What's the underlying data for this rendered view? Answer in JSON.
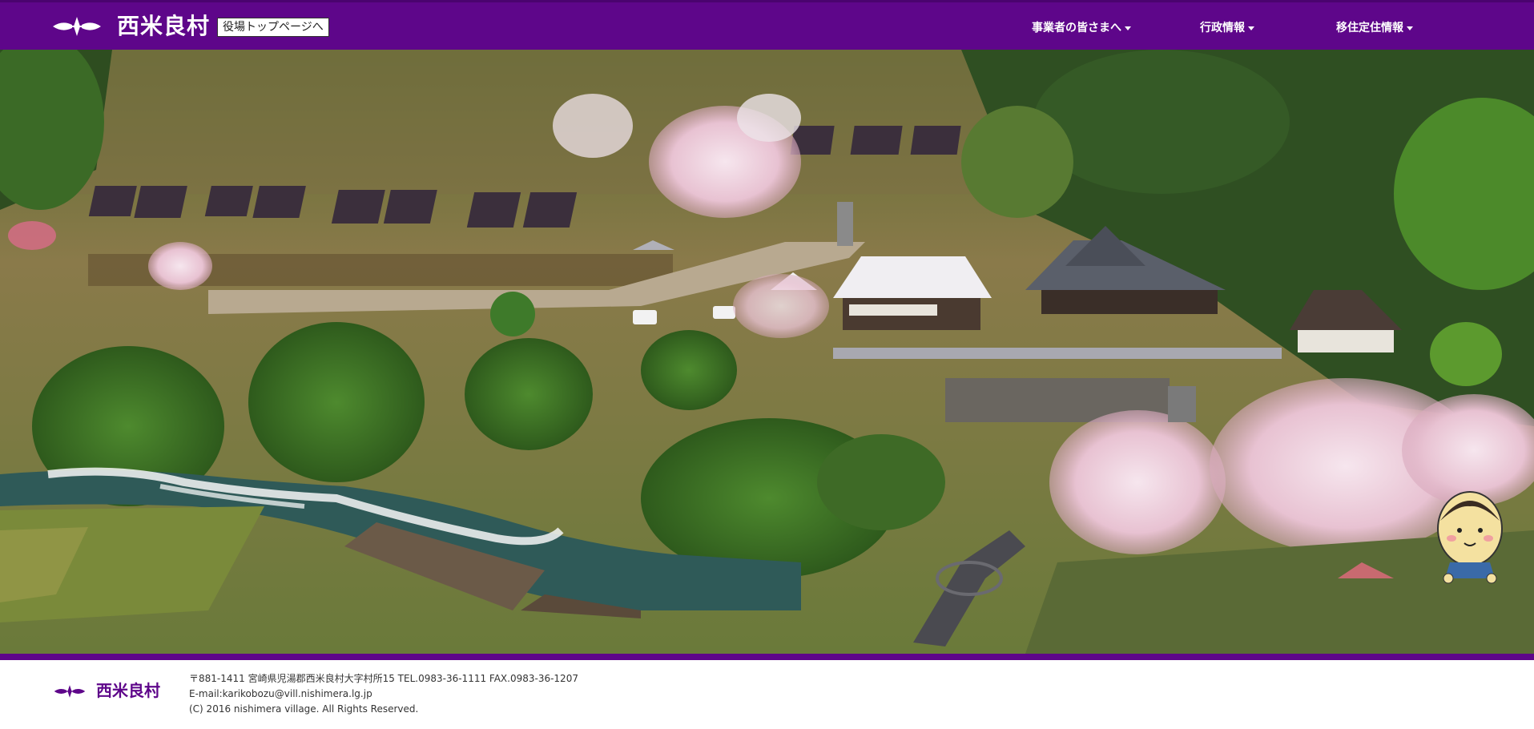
{
  "header": {
    "logo_text": "西米良村",
    "top_link": "役場トップページへ",
    "nav": [
      {
        "label": "事業者の皆さまへ"
      },
      {
        "label": "行政情報"
      },
      {
        "label": "移住定住情報"
      }
    ]
  },
  "colors": {
    "brand_purple": "#5e068a",
    "header_text": "#ffffff"
  },
  "hero": {
    "icon": "aerial-village-photo"
  },
  "footer": {
    "logo_text": "西米良村",
    "address": "〒881-1411 宮崎県児湯郡西米良村大字村所15 TEL.0983-36-1111 FAX.0983-36-1207",
    "email": "E-mail:karikobozu@vill.nishimera.lg.jp",
    "copyright": "(C) 2016 nishimera village. All Rights Reserved."
  }
}
